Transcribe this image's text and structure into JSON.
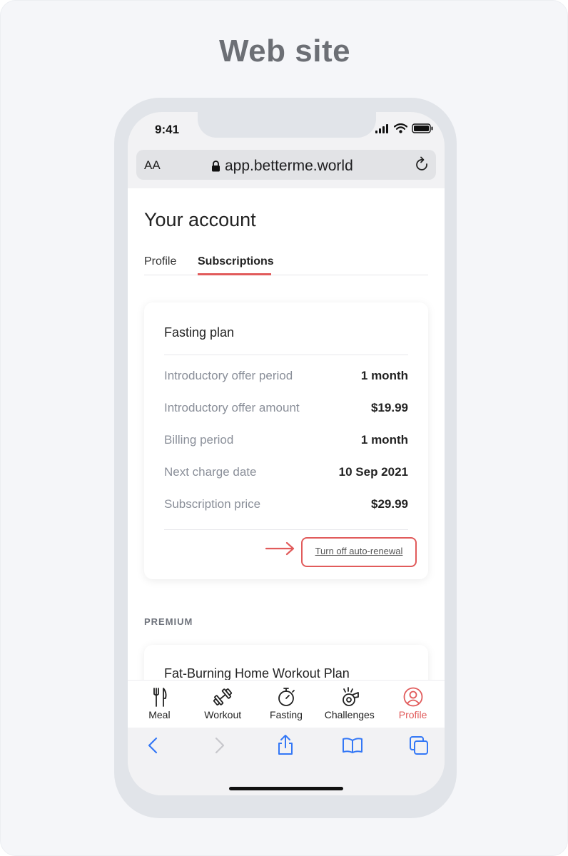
{
  "heading": "Web site",
  "status_bar": {
    "time": "9:41"
  },
  "browser": {
    "aa_label": "AA",
    "url": "app.betterme.world"
  },
  "page": {
    "title": "Your account",
    "tabs": [
      {
        "label": "Profile",
        "active": false
      },
      {
        "label": "Subscriptions",
        "active": true
      }
    ]
  },
  "subscription_card": {
    "title": "Fasting plan",
    "rows": [
      {
        "label": "Introductory offer period",
        "value": "1 month"
      },
      {
        "label": "Introductory offer amount",
        "value": "$19.99"
      },
      {
        "label": "Billing period",
        "value": "1 month"
      },
      {
        "label": "Next charge date",
        "value": "10 Sep 2021"
      },
      {
        "label": "Subscription price",
        "value": "$29.99"
      }
    ],
    "turn_off_link": "Turn off auto-renewal"
  },
  "premium_section": {
    "label": "PREMIUM",
    "card_title": "Fat-Burning Home Workout Plan"
  },
  "help_button": {
    "icon": "question-circle-icon"
  },
  "bottom_nav": [
    {
      "label": "Meal",
      "icon": "fork-knife-icon",
      "active": false
    },
    {
      "label": "Workout",
      "icon": "dumbbell-icon",
      "active": false
    },
    {
      "label": "Fasting",
      "icon": "stopwatch-icon",
      "active": false
    },
    {
      "label": "Challenges",
      "icon": "whistle-icon",
      "active": false
    },
    {
      "label": "Profile",
      "icon": "profile-icon",
      "active": true
    }
  ],
  "browser_toolbar": [
    "back-icon",
    "forward-icon",
    "share-icon",
    "bookmarks-icon",
    "tabs-icon"
  ],
  "colors": {
    "accent": "#e15b5b",
    "browser_blue": "#3478f6",
    "text_primary": "#222222",
    "text_secondary": "#8a8f99",
    "background": "#f5f6f9"
  }
}
